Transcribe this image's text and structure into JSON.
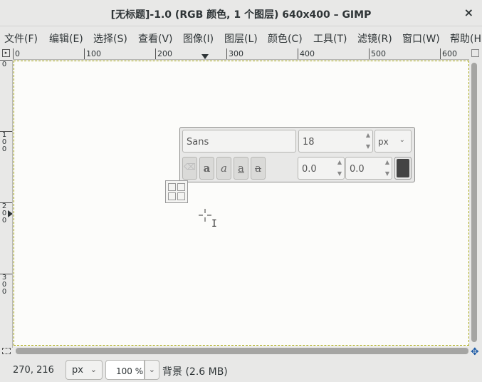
{
  "window": {
    "title": "[无标题]-1.0 (RGB 颜色, 1 个图层) 640x400 – GIMP",
    "close_glyph": "×"
  },
  "menu": {
    "items": [
      "文件(F)",
      "编辑(E)",
      "选择(S)",
      "查看(V)",
      "图像(I)",
      "图层(L)",
      "颜色(C)",
      "工具(T)",
      "滤镜(R)",
      "窗口(W)",
      "帮助(H)"
    ]
  },
  "rulers": {
    "horizontal_labels": [
      "0",
      "100",
      "200",
      "300",
      "400",
      "500",
      "600"
    ],
    "vertical_labels": [
      "0",
      "100",
      "200",
      "300"
    ]
  },
  "text_tool": {
    "font": "Sans",
    "size": "18",
    "size_unit": "px",
    "style_buttons": [
      "clear-style",
      "bold",
      "italic",
      "underline",
      "strikethrough"
    ],
    "baseline_offset": "0.0",
    "kerning": "0.0",
    "text_color": "#444444"
  },
  "statusbar": {
    "coords": "270, 216",
    "unit": "px",
    "zoom": "100 %",
    "layer_info": "背景 (2.6 MB)"
  },
  "colors": {
    "canvas": "#fcfcfa",
    "chrome": "#e8e8e7",
    "canvas_boundary": "#a8a818"
  },
  "icons": {
    "quick-mask": "quick-mask-icon",
    "navigate": "navigate-icon",
    "ruler-menu": "menu-arrow-icon"
  }
}
